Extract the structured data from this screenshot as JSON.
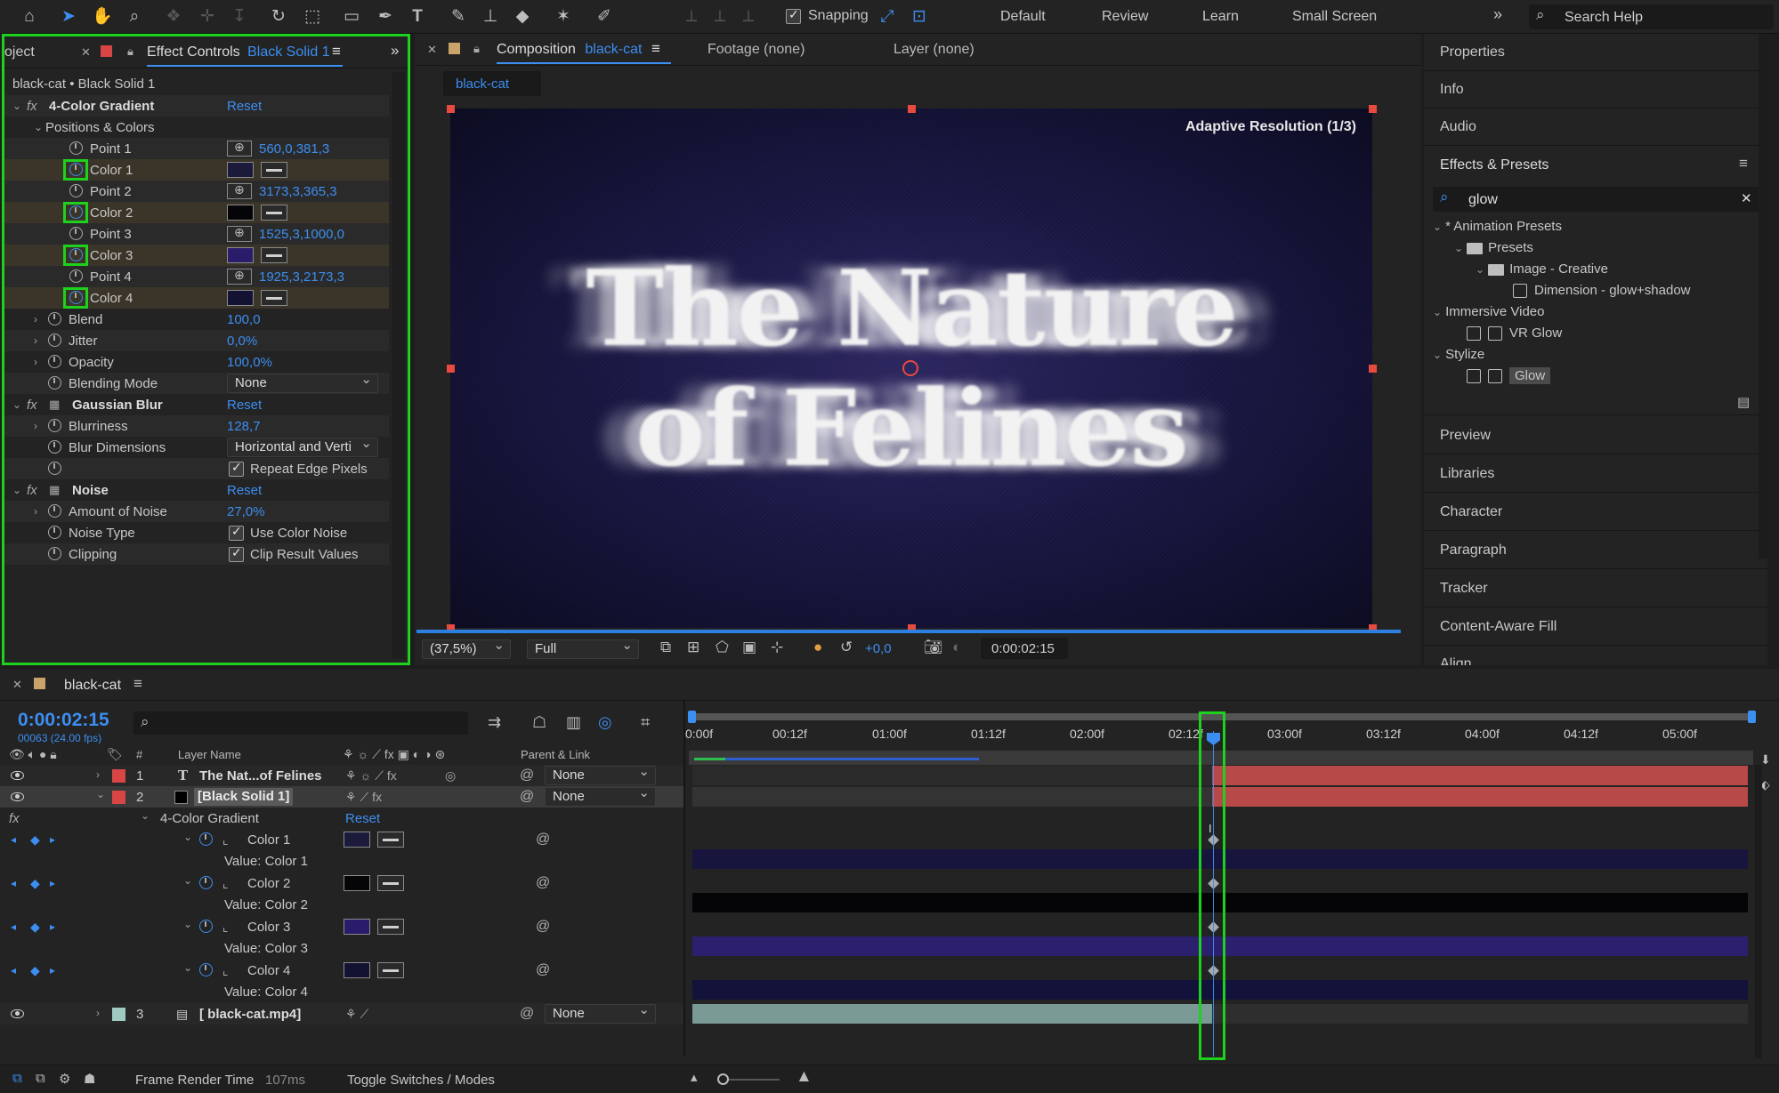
{
  "toolbar": {
    "snapping_label": "Snapping",
    "workspaces": [
      "Default",
      "Review",
      "Learn",
      "Small Screen"
    ],
    "search_placeholder": "Search Help",
    "icons": [
      "home-icon",
      "selection-arrow-icon",
      "hand-icon",
      "zoom-icon",
      "orbit-icon",
      "pan-behind-icon",
      "dolly-icon",
      "rotate-icon",
      "camera-icon",
      "rectangle-icon",
      "pen-icon",
      "type-icon",
      "brush-icon",
      "clone-stamp-icon",
      "eraser-icon",
      "roto-brush-icon",
      "puppet-pin-icon"
    ]
  },
  "effect_panel": {
    "project_tab": "oject",
    "tab_label": "Effect Controls",
    "tab_layer": "Black Solid 1",
    "breadcrumb": "black-cat • Black Solid 1",
    "effects": [
      {
        "name": "4-Color Gradient",
        "reset": "Reset"
      },
      {
        "name": "Gaussian Blur",
        "reset": "Reset"
      },
      {
        "name": "Noise",
        "reset": "Reset"
      }
    ],
    "group_positions": "Positions & Colors",
    "points": [
      {
        "label": "Point 1",
        "value": "560,0,381,3"
      },
      {
        "label": "Point 2",
        "value": "3173,3,365,3"
      },
      {
        "label": "Point 3",
        "value": "1525,3,1000,0"
      },
      {
        "label": "Point 4",
        "value": "1925,3,2173,3"
      }
    ],
    "colors": [
      {
        "label": "Color 1",
        "hex": "#1b1a3a"
      },
      {
        "label": "Color 2",
        "hex": "#050508"
      },
      {
        "label": "Color 3",
        "hex": "#2a1c6a"
      },
      {
        "label": "Color 4",
        "hex": "#141232"
      }
    ],
    "blend": {
      "label": "Blend",
      "value": "100,0"
    },
    "jitter": {
      "label": "Jitter",
      "value": "0,0%"
    },
    "opacity": {
      "label": "Opacity",
      "value": "100,0%"
    },
    "blending_mode": {
      "label": "Blending Mode",
      "value": "None"
    },
    "blurriness": {
      "label": "Blurriness",
      "value": "128,7"
    },
    "blur_dimensions": {
      "label": "Blur Dimensions",
      "value": "Horizontal and Verti"
    },
    "repeat_edge": "Repeat Edge Pixels",
    "amount_noise": {
      "label": "Amount of Noise",
      "value": "27,0%"
    },
    "noise_type": {
      "label": "Noise Type",
      "value": "Use Color Noise"
    },
    "clipping": {
      "label": "Clipping",
      "value": "Clip Result Values"
    }
  },
  "comp_panel": {
    "tab_label": "Composition",
    "tab_comp": "black-cat",
    "footage_tab": "Footage (none)",
    "layer_tab": "Layer (none)",
    "subtab": "black-cat",
    "adaptive": "Adaptive Resolution (1/3)",
    "title_line1": "The Nature",
    "title_line2": "of Felines",
    "zoom": "(37,5%)",
    "resolution": "Full",
    "exposure": "+0,0",
    "timecode": "0:00:02:15"
  },
  "right_panel": {
    "top_items": [
      "Properties",
      "Info",
      "Audio"
    ],
    "effects_title": "Effects & Presets",
    "search_value": "glow",
    "tree": [
      {
        "label": "* Animation Presets",
        "level": 0,
        "type": "group"
      },
      {
        "label": "Presets",
        "level": 1,
        "type": "folder"
      },
      {
        "label": "Image - Creative",
        "level": 2,
        "type": "folder"
      },
      {
        "label": "Dimension - glow+shadow",
        "level": 3,
        "type": "preset"
      },
      {
        "label": "Immersive Video",
        "level": 0,
        "type": "group"
      },
      {
        "label": "VR Glow",
        "level": 1,
        "type": "effect"
      },
      {
        "label": "Stylize",
        "level": 0,
        "type": "group"
      },
      {
        "label": "Glow",
        "level": 1,
        "type": "effect",
        "selected": true
      }
    ],
    "bottom_items": [
      "Preview",
      "Libraries",
      "Character",
      "Paragraph",
      "Tracker",
      "Content-Aware Fill",
      "Align"
    ]
  },
  "timeline": {
    "comp_name": "black-cat",
    "timecode": "0:00:02:15",
    "frame_info": "00063 (24.00 fps)",
    "col_layer_name": "Layer Name",
    "col_parent": "Parent & Link",
    "col_num": "#",
    "ruler": [
      "0:00f",
      "00:12f",
      "01:00f",
      "01:12f",
      "02:00f",
      "02:12f",
      "03:00f",
      "03:12f",
      "04:00f",
      "04:12f",
      "05:00f"
    ],
    "layers": [
      {
        "num": "1",
        "name": "The Nat...of Felines",
        "label_color": "#d84545",
        "parent": "None",
        "type": "T"
      },
      {
        "num": "2",
        "name": "[Black Solid 1]",
        "label_color": "#d84545",
        "parent": "None",
        "type": "solid"
      },
      {
        "num": "3",
        "name": "[ black-cat.mp4]",
        "label_color": "#9fcac1",
        "parent": "None",
        "type": "footage"
      }
    ],
    "effect_name": "4-Color Gradient",
    "effect_reset": "Reset",
    "color_props": [
      {
        "label": "Color 1",
        "value_label": "Value: Color 1",
        "hex": "#1b1a3a",
        "bar": "#17153d"
      },
      {
        "label": "Color 2",
        "value_label": "Value: Color 2",
        "hex": "#050508",
        "bar": "#050508"
      },
      {
        "label": "Color 3",
        "value_label": "Value: Color 3",
        "hex": "#2a1c6a",
        "bar": "#2b1f6e"
      },
      {
        "label": "Color 4",
        "value_label": "Value: Color 4",
        "hex": "#141232",
        "bar": "#13123a"
      }
    ],
    "footer_render_label": "Frame Render Time",
    "footer_render_value": "107ms",
    "footer_toggle": "Toggle Switches / Modes"
  }
}
